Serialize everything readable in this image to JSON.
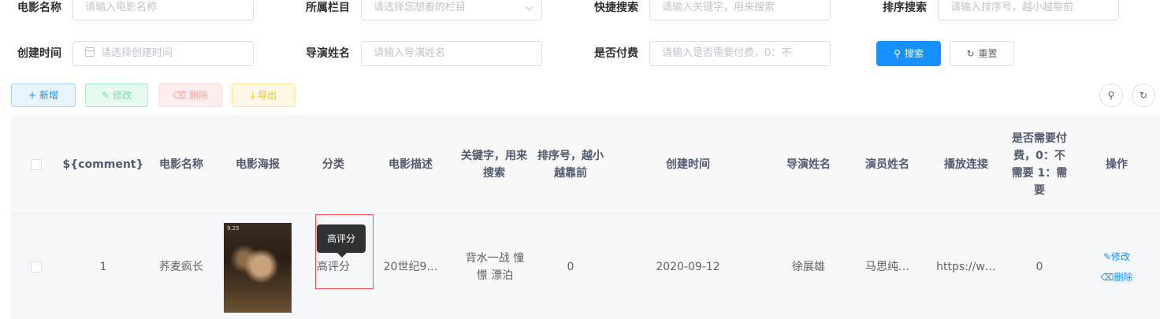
{
  "filters": {
    "movie_name": {
      "label": "电影名称",
      "placeholder": "请输入电影名称"
    },
    "column": {
      "label": "所属栏目",
      "placeholder": "请选择您想看的栏目"
    },
    "quick_search": {
      "label": "快捷搜索",
      "placeholder": "请输入关键字，用来搜索"
    },
    "sort_search": {
      "label": "排序搜索",
      "placeholder": "请输入排序号，越小越靠前"
    },
    "created_time": {
      "label": "创建时间",
      "placeholder": "请选择创建时间"
    },
    "director": {
      "label": "导演姓名",
      "placeholder": "请输入导演姓名"
    },
    "paid": {
      "label": "是否付费",
      "placeholder": "请输入是否需要付费，0：不"
    },
    "search_button": "搜索",
    "reset_button": "重置"
  },
  "toolbar": {
    "add": "新增",
    "edit": "修改",
    "delete": "删除",
    "export": "导出",
    "search_icon": "search-icon",
    "refresh_icon": "refresh-icon"
  },
  "table": {
    "headers": [
      "${comment}",
      "电影名称",
      "电影海报",
      "分类",
      "电影描述",
      "关键字，用来搜索",
      "排序号，越小越靠前",
      "创建时间",
      "导演姓名",
      "演员姓名",
      "播放连接",
      "是否需要付费，0：不需要 1：需要",
      "操作"
    ],
    "rows": [
      {
        "id": "1",
        "name": "荞麦疯长",
        "poster_text": "9.25",
        "category": "高评分",
        "description": "20世纪9…",
        "keywords": "背水一战 憧憬 漂泊",
        "sort": "0",
        "created": "2020-09-12",
        "director": "徐展雄",
        "actors": "马思纯…",
        "link": "https://w…",
        "paid": "0",
        "op_edit": "修改",
        "op_delete": "删除"
      }
    ],
    "tooltip": "高评分"
  },
  "colors": {
    "primary": "#1890ff",
    "highlight_border": "#ff4d4f"
  }
}
